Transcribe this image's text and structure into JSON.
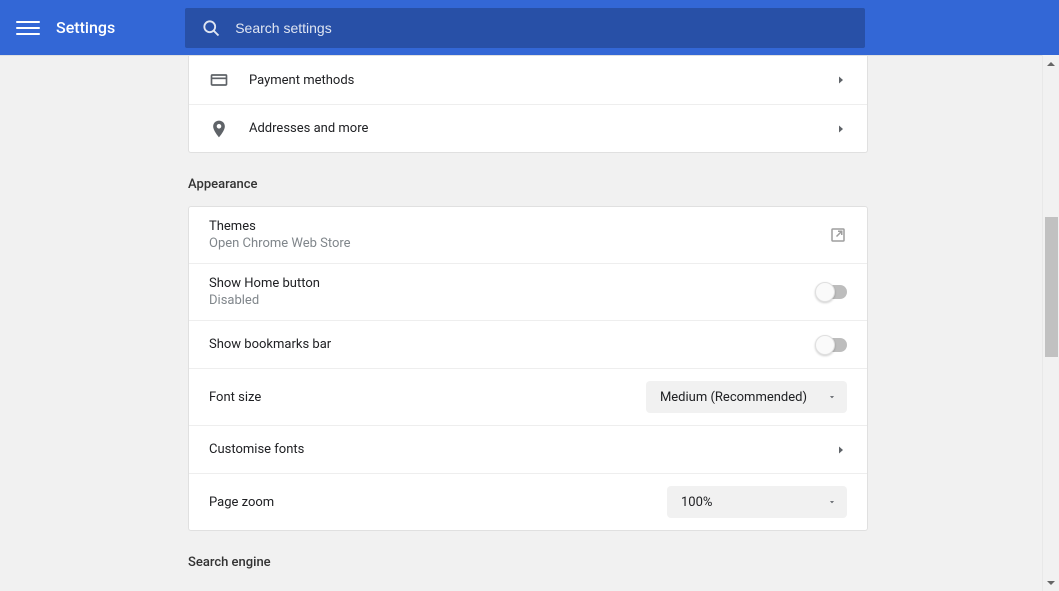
{
  "header": {
    "title": "Settings",
    "search_placeholder": "Search settings"
  },
  "autofill": {
    "payment_label": "Payment methods",
    "addresses_label": "Addresses and more"
  },
  "appearance": {
    "section_title": "Appearance",
    "themes_label": "Themes",
    "themes_sub": "Open Chrome Web Store",
    "home_button_label": "Show Home button",
    "home_button_sub": "Disabled",
    "bookmarks_label": "Show bookmarks bar",
    "font_size_label": "Font size",
    "font_size_value": "Medium (Recommended)",
    "customise_fonts_label": "Customise fonts",
    "page_zoom_label": "Page zoom",
    "page_zoom_value": "100%"
  },
  "search_engine": {
    "section_title": "Search engine"
  }
}
